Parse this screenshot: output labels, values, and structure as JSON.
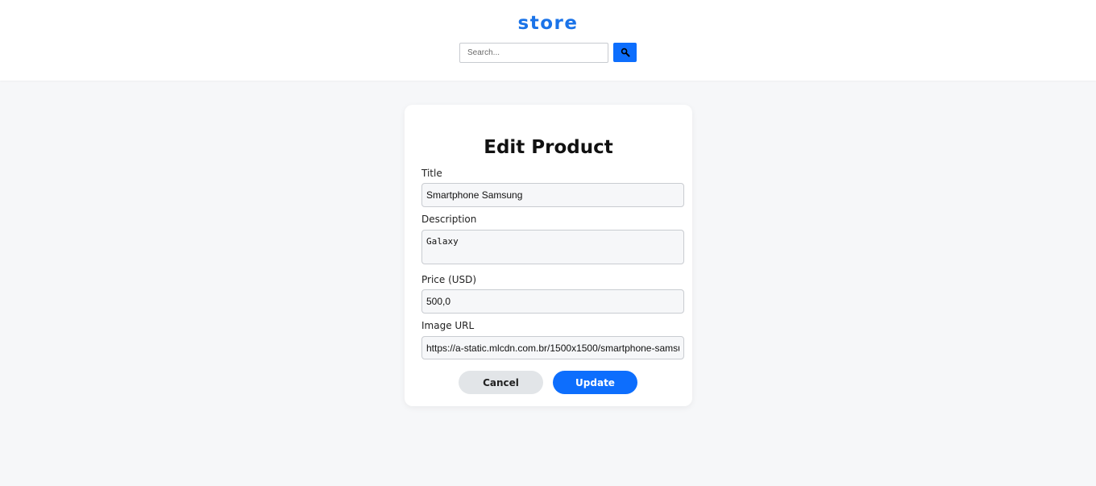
{
  "header": {
    "brand": "store",
    "search": {
      "placeholder": "Search...",
      "value": ""
    },
    "search_icon": "magnifier-icon"
  },
  "form": {
    "title": "Edit Product",
    "fields": {
      "title": {
        "label": "Title",
        "value": "Smartphone Samsung"
      },
      "description": {
        "label": "Description",
        "value": "Galaxy"
      },
      "price": {
        "label": "Price (USD)",
        "value": "500,0"
      },
      "image_url": {
        "label": "Image URL",
        "value": "https://a-static.mlcdn.com.br/1500x1500/smartphone-samsu"
      }
    },
    "cancel_label": "Cancel",
    "update_label": "Update"
  },
  "colors": {
    "primary": "#0d6efd",
    "brand": "#1a73e8",
    "background": "#f6f7f9",
    "cancel_bg": "#e2e5e8"
  }
}
